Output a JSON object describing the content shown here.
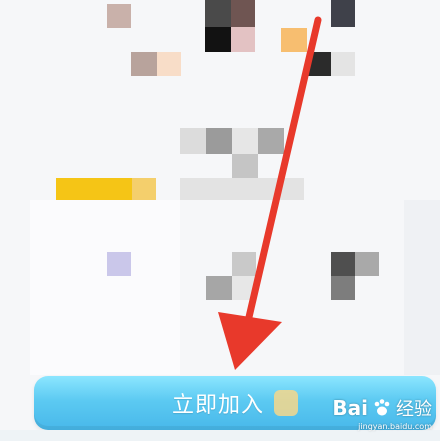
{
  "cta_button": {
    "label": "立即加入"
  },
  "watermark": {
    "brand": "Bai",
    "brand_suffix": "经验",
    "url": "jingyan.baidu.com"
  },
  "annotation": {
    "arrow_color": "#e8392b"
  },
  "mosaic_colors": {
    "gray_dark": "#4a4a4a",
    "gray_mid": "#a7a7a7",
    "gray_light": "#d4d4d4",
    "tan": "#b59e96",
    "peach": "#f8ddc8",
    "yellow": "#f5c516",
    "lavender": "#cac7ea",
    "orange": "#f7be70",
    "black": "#121212",
    "pink": "#e3c2c3",
    "slate": "#3f414a"
  }
}
